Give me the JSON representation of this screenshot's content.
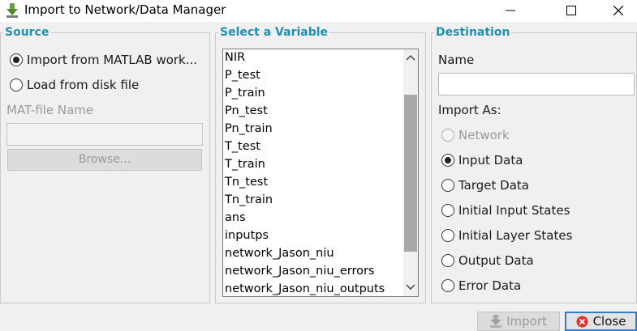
{
  "window": {
    "title": "Import to Network/Data Manager"
  },
  "source": {
    "title": "Source",
    "option_matlab": "Import from MATLAB work...",
    "option_disk": "Load from disk file",
    "selected": "matlab",
    "matfile_label": "MAT-file Name",
    "matfile_value": "",
    "browse_label": "Browse..."
  },
  "variable": {
    "title": "Select a Variable",
    "items": [
      "NIR",
      "P_test",
      "P_train",
      "Pn_test",
      "Pn_train",
      "T_test",
      "T_train",
      "Tn_test",
      "Tn_train",
      "ans",
      "inputps",
      "network_Jason_niu",
      "network_Jason_niu_errors",
      "network_Jason_niu_outputs"
    ]
  },
  "destination": {
    "title": "Destination",
    "name_label": "Name",
    "name_value": "",
    "import_as_label": "Import As:",
    "options": [
      {
        "label": "Network",
        "checked": false,
        "disabled": true
      },
      {
        "label": "Input Data",
        "checked": true,
        "disabled": false
      },
      {
        "label": "Target Data",
        "checked": false,
        "disabled": false
      },
      {
        "label": "Initial Input States",
        "checked": false,
        "disabled": false
      },
      {
        "label": "Initial Layer States",
        "checked": false,
        "disabled": false
      },
      {
        "label": "Output Data",
        "checked": false,
        "disabled": false
      },
      {
        "label": "Error Data",
        "checked": false,
        "disabled": false
      }
    ]
  },
  "buttons": {
    "import_label": "Import",
    "close_label": "Close"
  },
  "colors": {
    "section_title": "#1d8fb0",
    "close_icon": "#d9362b"
  },
  "icons": {
    "app": "matlab-down-arrow-icon",
    "minimize": "minimize-icon",
    "maximize": "maximize-icon",
    "close": "close-icon",
    "import": "import-icon",
    "close_button": "close-circle-icon"
  }
}
